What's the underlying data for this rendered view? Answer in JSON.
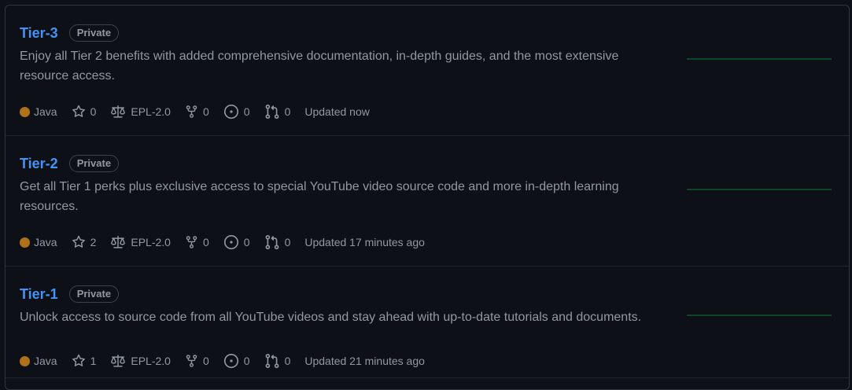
{
  "repos": [
    {
      "name": "Tier-3",
      "visibility": "Private",
      "description": "Enjoy all Tier 2 benefits with added comprehensive documentation, in-depth guides, and the most extensive resource access.",
      "language": "Java",
      "stars": "0",
      "license": "EPL-2.0",
      "forks": "0",
      "issues": "0",
      "pulls": "0",
      "updated": "Updated now"
    },
    {
      "name": "Tier-2",
      "visibility": "Private",
      "description": "Get all Tier 1 perks plus exclusive access to special YouTube video source code and more in-depth learning resources.",
      "language": "Java",
      "stars": "2",
      "license": "EPL-2.0",
      "forks": "0",
      "issues": "0",
      "pulls": "0",
      "updated": "Updated 17 minutes ago"
    },
    {
      "name": "Tier-1",
      "visibility": "Private",
      "description": "Unlock access to source code from all YouTube videos and stay ahead with up-to-date tutorials and documents.",
      "language": "Java",
      "stars": "1",
      "license": "EPL-2.0",
      "forks": "0",
      "issues": "0",
      "pulls": "0",
      "updated": "Updated 21 minutes ago"
    }
  ],
  "colors": {
    "background": "#0d1117",
    "link": "#4493f8",
    "muted_text": "#9198a1",
    "java_language": "#b07219",
    "sparkline": "#0e4429"
  },
  "icons": {
    "star": "star-icon",
    "license": "law-icon",
    "fork": "repo-forked-icon",
    "issue": "issue-opened-icon",
    "pull": "git-pull-request-icon"
  }
}
